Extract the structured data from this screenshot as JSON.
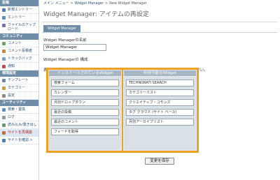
{
  "sidebar": {
    "sections": [
      {
        "title": "投稿",
        "items": [
          {
            "label": "新規エントリー",
            "icon": "new-entry-icon",
            "color": "#4a7fb5",
            "highlight": false
          },
          {
            "label": "エントリー",
            "icon": "entries-icon",
            "color": "#5a8fc5",
            "highlight": false
          },
          {
            "label": "ファイルのアップロード",
            "icon": "upload-icon",
            "color": "#7a6fb0",
            "highlight": false
          }
        ]
      },
      {
        "title": "コミュニティ",
        "items": [
          {
            "label": "コメント",
            "icon": "comment-icon",
            "color": "#6aa56a",
            "highlight": false
          },
          {
            "label": "コメント投稿者",
            "icon": "commenter-icon",
            "color": "#c8883a",
            "highlight": false
          },
          {
            "label": "トラックバック",
            "icon": "trackback-icon",
            "color": "#7fa0c4",
            "highlight": false
          },
          {
            "label": "通知",
            "icon": "notification-icon",
            "color": "#c84a4a",
            "highlight": false
          }
        ]
      },
      {
        "title": "環境設定",
        "items": [
          {
            "label": "テンプレート",
            "icon": "template-icon",
            "color": "#6a8ab0",
            "highlight": false
          },
          {
            "label": "カテゴリー",
            "icon": "category-icon",
            "color": "#d0a040",
            "highlight": false
          },
          {
            "label": "設定",
            "icon": "settings-icon",
            "color": "#8a8a8a",
            "highlight": false
          }
        ]
      },
      {
        "title": "ユーティリティ",
        "items": [
          {
            "label": "検索・置換",
            "icon": "search-icon",
            "color": "#5a8fc5",
            "highlight": false
          },
          {
            "label": "ログ",
            "icon": "log-icon",
            "color": "#8a9aa8",
            "highlight": false
          },
          {
            "label": "読み込み/書き出し",
            "icon": "import-export-icon",
            "color": "#6a9a6a",
            "highlight": false
          },
          {
            "label": "サイトを再構築",
            "icon": "rebuild-icon",
            "color": "#c86a3a",
            "highlight": true
          },
          {
            "label": "サイトを確認 >",
            "icon": "view-site-icon",
            "color": "#4a7fb5",
            "highlight": false
          }
        ]
      }
    ]
  },
  "breadcrumb": [
    "メイン メニュー",
    "Widget Manager",
    "New Widget Manager"
  ],
  "breadcrumb_separator": ">",
  "page_title": "Widget Manager: アイテムの再設定",
  "tab_label": "Widget Manager",
  "name_field": {
    "label": "Widget Managerの名前",
    "value": "Widget Manager"
  },
  "composition_label": "Widget Managerの 構成",
  "instruction": "表示するWidgetを[インストールされているWidget]にドラッグアンドドロップしてください。",
  "installed": {
    "title": "インストールされているWidget",
    "widgets": [
      "検索フォーム",
      "カレンダー",
      "月別ドロップダウン",
      "最近の投稿",
      "最近のコメント",
      "フィードを取得"
    ]
  },
  "available": {
    "title": "利用可能なWidget",
    "widgets": [
      "TECHNORATI SEARCH",
      "カテゴリーリスト",
      "クリエイティブ・コモンズ",
      "タグ クラウド (サイト ベース)",
      "月別アーカイブリスト"
    ]
  },
  "save_button": "変更を保存",
  "colors": {
    "accent": "#6f8da6",
    "dnd_border": "#f0a020",
    "link": "#2a4f7a",
    "highlight_text": "#b0302a"
  }
}
